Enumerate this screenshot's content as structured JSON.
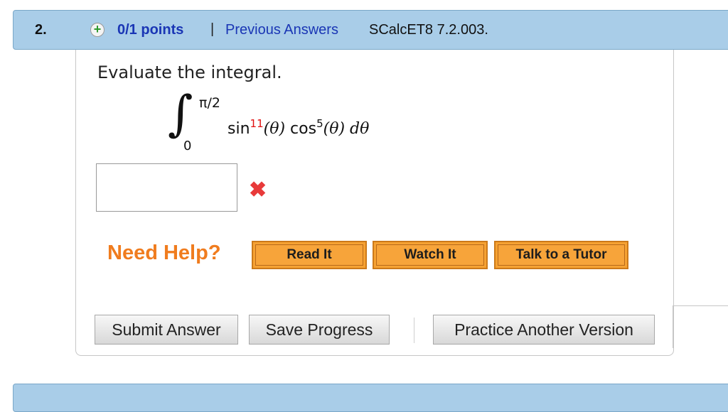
{
  "question": {
    "number": "2.",
    "points": "0/1 points",
    "separator": "|",
    "previous_answers": "Previous Answers",
    "source": "SCalcET8 7.2.003."
  },
  "problem": {
    "prompt": "Evaluate the integral.",
    "integral": {
      "upper_limit": "π/2",
      "lower_limit": "0",
      "sin": "sin",
      "sin_power": "11",
      "theta1": "(θ)",
      "cos": "cos",
      "cos_power": "5",
      "theta2": "(θ)",
      "d": "d",
      "theta3": "θ"
    }
  },
  "answer": {
    "value": "",
    "status": "incorrect",
    "status_glyph": "✖"
  },
  "help": {
    "label": "Need Help?",
    "read_it": "Read It",
    "watch_it": "Watch It",
    "talk_to_tutor": "Talk to a Tutor"
  },
  "actions": {
    "submit": "Submit Answer",
    "save": "Save Progress",
    "practice": "Practice Another Version"
  },
  "colors": {
    "header_bg": "#a9cde8",
    "link": "#1a36b5",
    "help_orange": "#f07c1e",
    "button_orange": "#f6a233",
    "error_red": "#e83a3a"
  }
}
